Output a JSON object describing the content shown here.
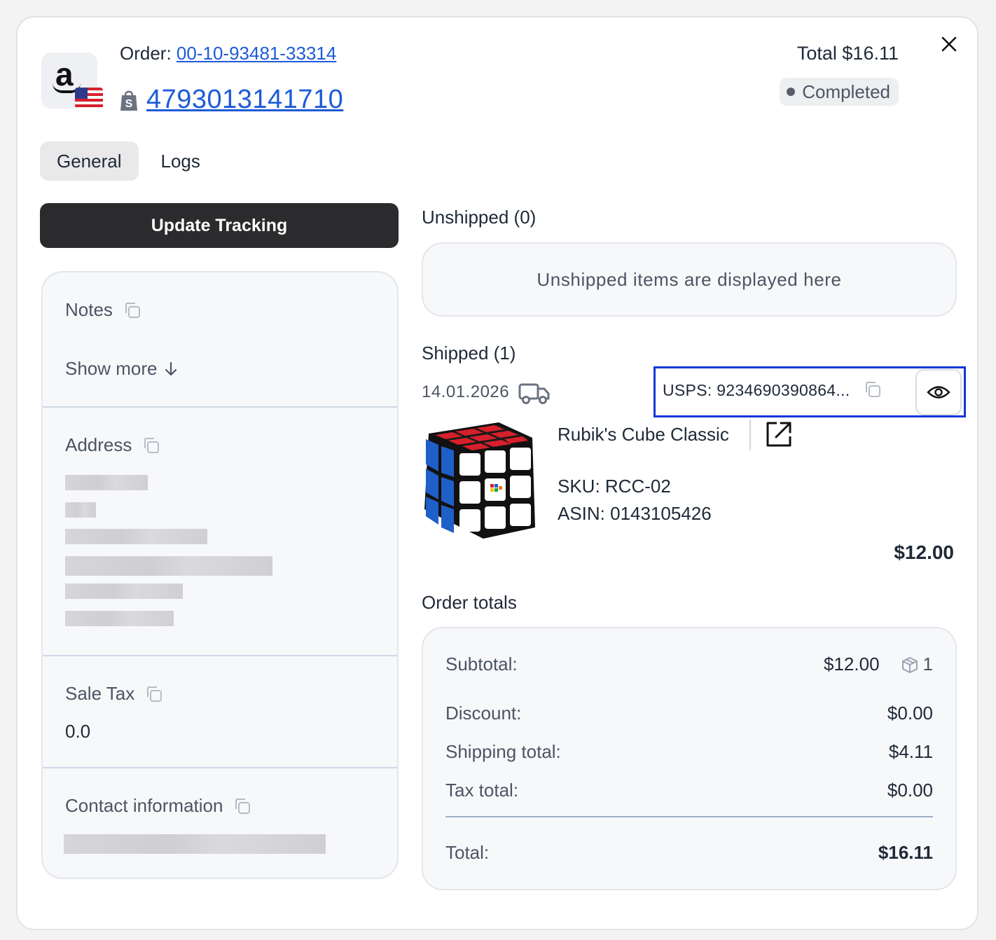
{
  "header": {
    "order_label": "Order:",
    "order_number": "00-10-93481-33314",
    "shop_order_number": "4793013141710",
    "total_text": "Total $16.11",
    "status": "Completed"
  },
  "tabs": [
    {
      "label": "General",
      "active": true
    },
    {
      "label": "Logs",
      "active": false
    }
  ],
  "left": {
    "update_tracking_label": "Update Tracking",
    "notes_title": "Notes",
    "show_more_label": "Show more",
    "address_title": "Address",
    "sale_tax_title": "Sale Tax",
    "sale_tax_value": "0.0",
    "contact_title": "Contact information"
  },
  "unshipped": {
    "title": "Unshipped (0)",
    "placeholder": "Unshipped items are displayed here"
  },
  "shipped": {
    "title": "Shipped (1)",
    "date": "14.01.2026",
    "tracking": "USPS: 9234690390864...",
    "product": {
      "name": "Rubik's Cube Classic",
      "sku": "SKU: RCC-02",
      "asin": "ASIN: 0143105426",
      "price": "$12.00"
    }
  },
  "totals": {
    "title": "Order totals",
    "subtotal_label": "Subtotal:",
    "subtotal_value": "$12.00",
    "item_count": "1",
    "discount_label": "Discount:",
    "discount_value": "$0.00",
    "shipping_label": "Shipping total:",
    "shipping_value": "$4.11",
    "tax_label": "Tax total:",
    "tax_value": "$0.00",
    "total_label": "Total:",
    "total_value": "$16.11"
  },
  "icons": {
    "close": "close-icon",
    "copy": "copy-icon",
    "eye": "eye-icon",
    "truck": "truck-icon",
    "external": "external-link-icon",
    "box": "box-icon",
    "shopify": "shopify-bag-icon"
  },
  "colors": {
    "link": "#1d5bd8",
    "highlight_border": "#1137d8",
    "primary_button": "#2b2b2d"
  }
}
